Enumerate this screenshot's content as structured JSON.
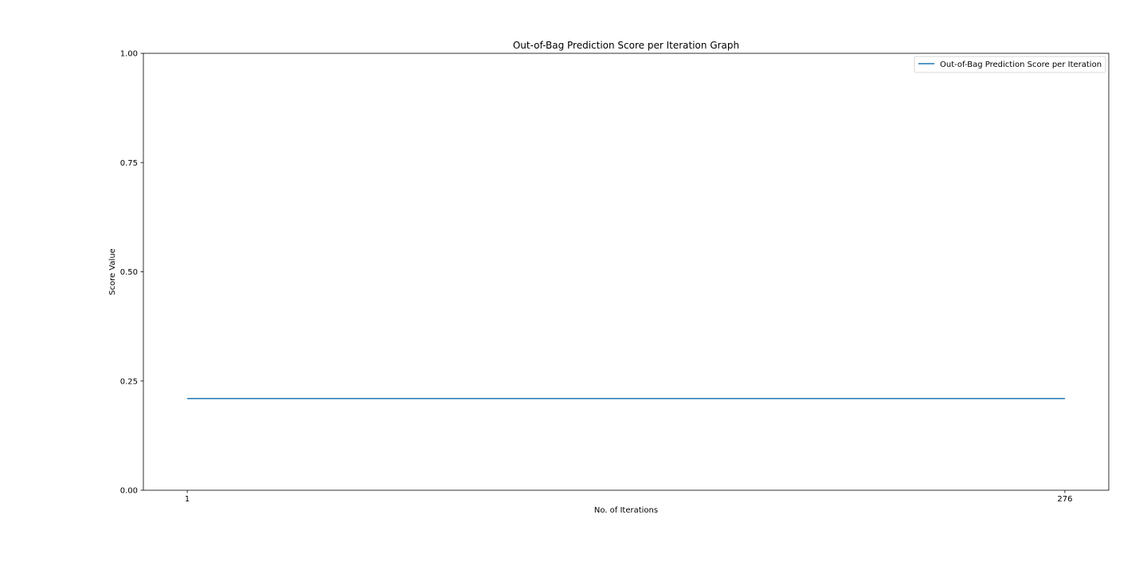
{
  "chart_data": {
    "type": "line",
    "title": "Out-of-Bag Prediction Score per Iteration Graph",
    "xlabel": "No. of Iterations",
    "ylabel": "Score Value",
    "x": [
      1,
      276
    ],
    "xticks": [
      1,
      276
    ],
    "xtick_labels": [
      "1",
      "276"
    ],
    "xlim": [
      -12.75,
      289.75
    ],
    "ylim": [
      0,
      1
    ],
    "yticks": [
      0,
      0.25,
      0.5,
      0.75,
      1
    ],
    "ytick_labels": [
      "0.00",
      "0.25",
      "0.50",
      "0.75",
      "1.00"
    ],
    "grid": false,
    "legend_position": "top-right",
    "series": [
      {
        "name": "Out-of-Bag Prediction Score per Iteration",
        "color": "#1f77b4",
        "values": [
          0.21,
          0.21
        ]
      }
    ]
  }
}
